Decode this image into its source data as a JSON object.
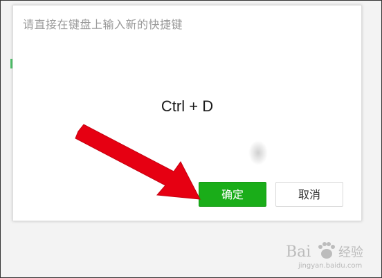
{
  "dialog": {
    "instruction": "请直接在键盘上输入新的快捷键",
    "shortcut": "Ctrl + D",
    "ok_label": "确定",
    "cancel_label": "取消"
  },
  "watermark": {
    "text": "Baidu 经验",
    "url": "jingyan.baidu.com"
  },
  "colors": {
    "ok_button": "#1aad19",
    "arrow": "#e60012"
  },
  "icons": {
    "arrow": "red-arrow-icon",
    "cursor": "mouse-cursor-icon",
    "logo": "baidu-paw-icon"
  }
}
